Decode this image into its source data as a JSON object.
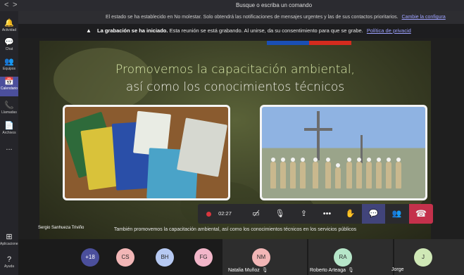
{
  "topbar": {
    "back": "<",
    "forward": ">",
    "search_placeholder": "Busque o escriba un comando"
  },
  "sidebar": {
    "items": [
      {
        "label": "Actividad",
        "icon": "bell-icon",
        "glyph": "🔔"
      },
      {
        "label": "Chat",
        "icon": "chat-icon",
        "glyph": "💬"
      },
      {
        "label": "Equipos",
        "icon": "teams-icon",
        "glyph": "👥"
      },
      {
        "label": "Calendario",
        "icon": "calendar-icon",
        "glyph": "📅"
      },
      {
        "label": "Llamadas",
        "icon": "phone-icon",
        "glyph": "📞"
      },
      {
        "label": "Archivos",
        "icon": "file-icon",
        "glyph": "📄"
      },
      {
        "label": "...",
        "icon": "more-icon",
        "glyph": ""
      },
      {
        "label": "Aplicaciones",
        "icon": "apps-icon",
        "glyph": "⊞"
      },
      {
        "label": "Ayuda",
        "icon": "help-icon",
        "glyph": "?"
      }
    ]
  },
  "status_banner": {
    "text": "El estado se ha establecido en No molestar. Solo obtendrá las notificaciones de mensajes urgentes y las de sus contactos prioritarios.",
    "link": "Cambie la configura"
  },
  "recording_banner": {
    "bold": "La grabación se ha iniciado.",
    "text": "Esta reunión se está grabando. Al unirse, da su consentimiento para que se grabe.",
    "link": "Política de privacid"
  },
  "slide": {
    "title_line1": "Promovemos la capacitación ambiental,",
    "title_line2": "así como los conocimientos técnicos"
  },
  "speaker_name": "Sergio Sanhueza Triviño",
  "caption": "También promovemos la capacitación ambiental, así como los conocimientos técnicos en los servicios públicos",
  "controls": {
    "timer": "02:27",
    "buttons": [
      {
        "name": "camera-off-button",
        "glyph": "▭̸"
      },
      {
        "name": "mic-off-button",
        "glyph": "🎙"
      },
      {
        "name": "share-button",
        "glyph": "⇪"
      },
      {
        "name": "more-options-button",
        "glyph": "•••"
      },
      {
        "name": "raise-hand-button",
        "glyph": "✋"
      },
      {
        "name": "chat-button",
        "glyph": "💬"
      },
      {
        "name": "participants-button",
        "glyph": "👥"
      },
      {
        "name": "hangup-button",
        "glyph": "☎"
      }
    ]
  },
  "participants": {
    "overflow": "+18",
    "avatars": [
      {
        "initials": "CS",
        "color": "#f2b6b6"
      },
      {
        "initials": "BH",
        "color": "#b6c9f2"
      },
      {
        "initials": "FG",
        "color": "#f2b6c9"
      }
    ],
    "tiles": [
      {
        "initials": "NM",
        "name": "Natalia Muñoz",
        "color": "#f2b6b6",
        "muted": true
      },
      {
        "initials": "RA",
        "name": "Roberto Arteaga",
        "color": "#b6e6c9",
        "muted": true
      },
      {
        "initials": "J",
        "name": "Jorge",
        "color": "#cfe8b6",
        "muted": false
      }
    ]
  },
  "colors": {
    "accent": "#4b4f9c",
    "recording": "#d9363e",
    "hangup": "#c4314b"
  }
}
